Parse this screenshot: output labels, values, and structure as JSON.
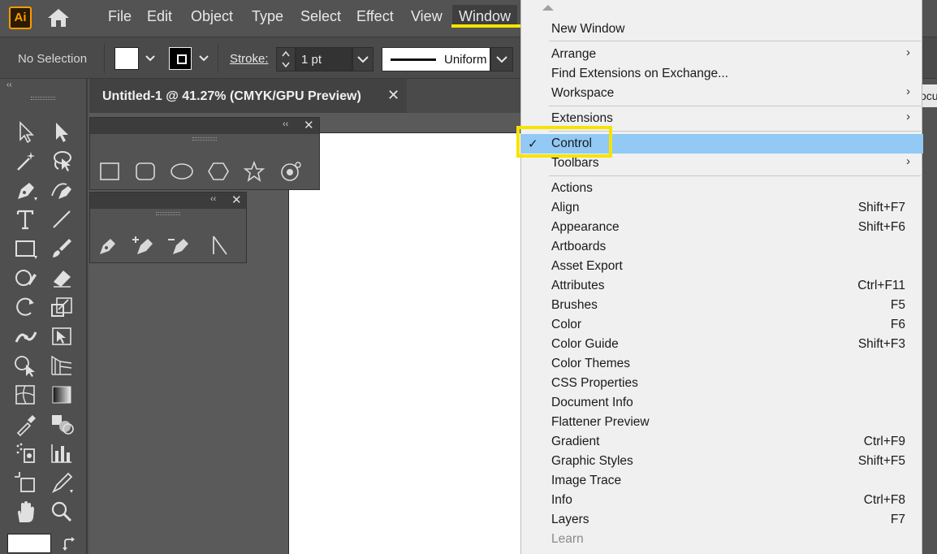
{
  "app": {
    "logo_text": "Ai",
    "accent_color": "#ff9a00",
    "highlight_color": "#f5e400"
  },
  "menubar": {
    "items": [
      "File",
      "Edit",
      "Object",
      "Type",
      "Select",
      "Effect",
      "View",
      "Window"
    ],
    "active": "Window"
  },
  "control": {
    "selection_label": "No Selection",
    "stroke_label": "Stroke:",
    "stroke_weight": "1 pt",
    "profile_label": "Uniform",
    "doc_edge_text": "ocu"
  },
  "document": {
    "tab_title": "Untitled-1 @ 41.27% (CMYK/GPU Preview)",
    "close_glyph": "✕"
  },
  "panels": {
    "shapes": {
      "collapse": "‹‹",
      "close": "✕"
    },
    "pen": {
      "collapse": "‹‹",
      "close": "✕"
    }
  },
  "toolbar": {
    "collapse": "‹‹"
  },
  "window_menu": {
    "items": [
      {
        "label": "New Window",
        "shortcut": "",
        "submenu": false
      },
      {
        "label": "Arrange",
        "shortcut": "",
        "submenu": true
      },
      {
        "label": "Find Extensions on Exchange...",
        "shortcut": "",
        "submenu": false
      },
      {
        "label": "Workspace",
        "shortcut": "",
        "submenu": true
      },
      {
        "label": "Extensions",
        "shortcut": "",
        "submenu": true
      },
      {
        "label": "Control",
        "shortcut": "",
        "submenu": false,
        "checked": true,
        "highlighted": true
      },
      {
        "label": "Toolbars",
        "shortcut": "",
        "submenu": true
      },
      {
        "label": "Actions",
        "shortcut": "",
        "submenu": false
      },
      {
        "label": "Align",
        "shortcut": "Shift+F7",
        "submenu": false
      },
      {
        "label": "Appearance",
        "shortcut": "Shift+F6",
        "submenu": false
      },
      {
        "label": "Artboards",
        "shortcut": "",
        "submenu": false
      },
      {
        "label": "Asset Export",
        "shortcut": "",
        "submenu": false
      },
      {
        "label": "Attributes",
        "shortcut": "Ctrl+F11",
        "submenu": false
      },
      {
        "label": "Brushes",
        "shortcut": "F5",
        "submenu": false
      },
      {
        "label": "Color",
        "shortcut": "F6",
        "submenu": false
      },
      {
        "label": "Color Guide",
        "shortcut": "Shift+F3",
        "submenu": false
      },
      {
        "label": "Color Themes",
        "shortcut": "",
        "submenu": false
      },
      {
        "label": "CSS Properties",
        "shortcut": "",
        "submenu": false
      },
      {
        "label": "Document Info",
        "shortcut": "",
        "submenu": false
      },
      {
        "label": "Flattener Preview",
        "shortcut": "",
        "submenu": false
      },
      {
        "label": "Gradient",
        "shortcut": "Ctrl+F9",
        "submenu": false
      },
      {
        "label": "Graphic Styles",
        "shortcut": "Shift+F5",
        "submenu": false
      },
      {
        "label": "Image Trace",
        "shortcut": "",
        "submenu": false
      },
      {
        "label": "Info",
        "shortcut": "Ctrl+F8",
        "submenu": false
      },
      {
        "label": "Layers",
        "shortcut": "F7",
        "submenu": false
      },
      {
        "label": "Learn",
        "shortcut": "",
        "submenu": false,
        "disabled": true
      }
    ],
    "checkmark": "✓",
    "submenu_glyph": "›",
    "highlight_color": "#92c9f5"
  }
}
